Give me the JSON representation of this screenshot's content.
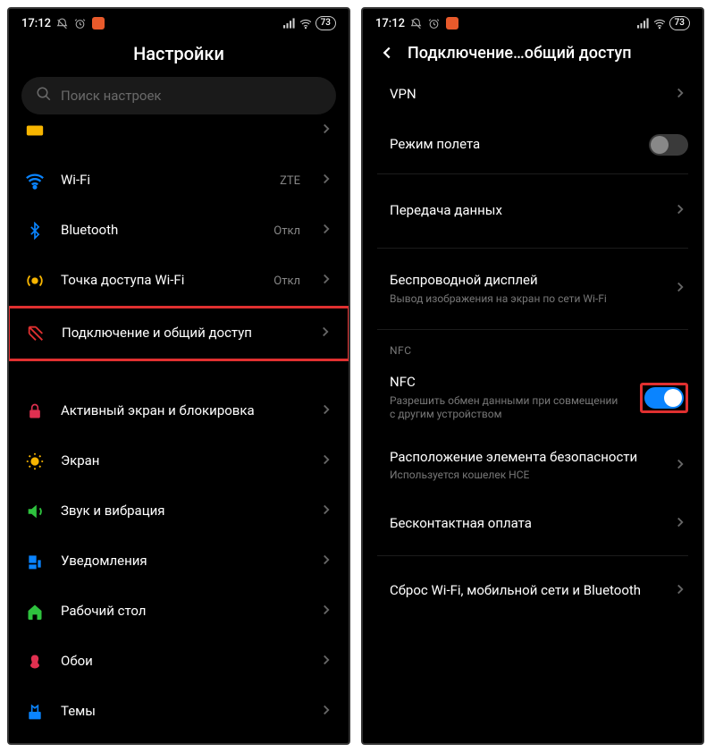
{
  "status": {
    "time": "17:12",
    "battery": "73"
  },
  "left": {
    "title": "Настройки",
    "search_placeholder": "Поиск настроек",
    "rows": {
      "sim": {
        "label": ""
      },
      "wifi": {
        "label": "Wi-Fi",
        "value": "ZTE"
      },
      "bluetooth": {
        "label": "Bluetooth",
        "value": "Откл"
      },
      "hotspot": {
        "label": "Точка доступа Wi-Fi",
        "value": "Откл"
      },
      "sharing": {
        "label": "Подключение и общий доступ"
      },
      "lock": {
        "label": "Активный экран и блокировка"
      },
      "display": {
        "label": "Экран"
      },
      "sound": {
        "label": "Звук и вибрация"
      },
      "notif": {
        "label": "Уведомления"
      },
      "home": {
        "label": "Рабочий стол"
      },
      "wallpaper": {
        "label": "Обои"
      },
      "themes": {
        "label": "Темы"
      }
    }
  },
  "right": {
    "title": "Подключение…общий доступ",
    "rows": {
      "vpn": {
        "label": "VPN"
      },
      "airplane": {
        "label": "Режим полета"
      },
      "data": {
        "label": "Передача данных"
      },
      "cast": {
        "label": "Беспроводной дисплей",
        "sub": "Вывод изображения на экран по сети Wi-Fi"
      },
      "nfc_section": "NFC",
      "nfc": {
        "label": "NFC",
        "sub": "Разрешить обмен данными при совмещении с другим устройством"
      },
      "secure": {
        "label": "Расположение элемента безопасности",
        "sub": "Используется кошелек HCE"
      },
      "pay": {
        "label": "Бесконтактная оплата"
      },
      "reset": {
        "label": "Сброс Wi-Fi, мобильной сети и Bluetooth"
      }
    }
  }
}
